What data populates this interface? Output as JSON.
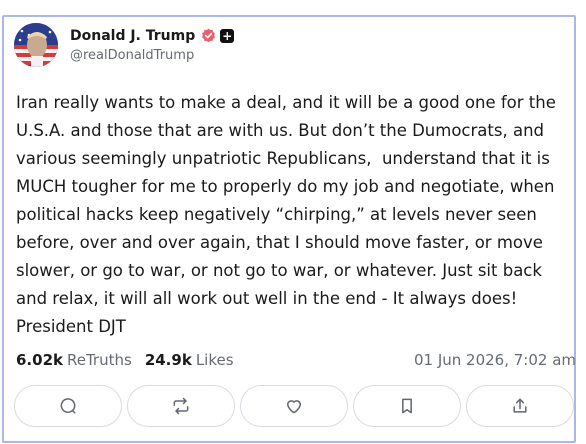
{
  "post": {
    "author": {
      "display_name": "Donald J. Trump",
      "handle": "@realDonaldTrump",
      "verified_icon": "verified-badge-icon",
      "badge_icon": "plus-badge-icon",
      "badge_symbol": "+"
    },
    "text": "Iran really wants to make a deal, and it will be a good one for the U.S.A. and those that are with us. But don’t the Dumocrats, and various seemingly unpatriotic Republicans,  understand that it is MUCH tougher for me to properly do my job and negotiate, when political hacks keep negatively “chirping,” at levels never seen before, over and over again, that I should move faster, or move slower, or go to war, or not go to war, or whatever. Just sit back and relax, it will all work out well in the end - It always does!\nPresident DJT",
    "stats": {
      "retruths_count": "6.02k",
      "retruths_label": "ReTruths",
      "likes_count": "24.9k",
      "likes_label": "Likes"
    },
    "timestamp": "01 Jun 2026, 7:02 am",
    "actions": [
      {
        "name": "reply",
        "icon": "comment-icon"
      },
      {
        "name": "retruth",
        "icon": "repost-icon"
      },
      {
        "name": "like",
        "icon": "heart-icon"
      },
      {
        "name": "bookmark",
        "icon": "bookmark-icon"
      },
      {
        "name": "share",
        "icon": "share-icon"
      }
    ]
  },
  "colors": {
    "card_border": "#aab8e6",
    "verified_badge": "#e8616f",
    "secondary_text": "#666a73",
    "action_border": "#d9dbe3"
  }
}
